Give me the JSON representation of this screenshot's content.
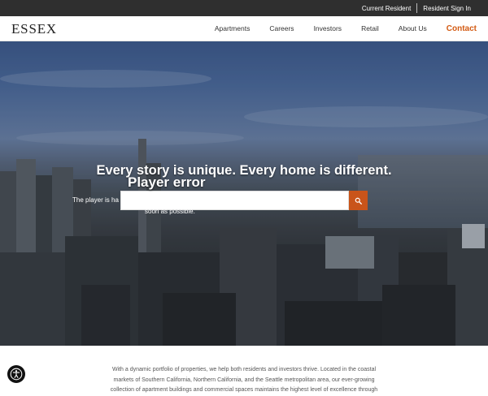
{
  "topbar": {
    "current_resident": "Current Resident",
    "resident_sign_in": "Resident Sign In"
  },
  "brand": {
    "logo": "ESSEX"
  },
  "nav": {
    "items": [
      "Apartments",
      "Careers",
      "Investors",
      "Retail",
      "About Us"
    ],
    "contact": "Contact"
  },
  "hero": {
    "headline": "Every story is unique. Every home is different.",
    "search_placeholder": "",
    "player_error_title": "Player error",
    "player_error_line1": "The player is ha",
    "player_error_line2": "soon as possible."
  },
  "about": {
    "text": "With a dynamic portfolio of properties, we help both residents and investors thrive. Located in the coastal markets of Southern California, Northern California, and the Seattle metropolitan area, our ever-growing collection of apartment buildings and commercial spaces maintains the highest level of excellence through"
  },
  "colors": {
    "accent": "#c9541a",
    "contact": "#d35a12",
    "topbar": "#2f2f2f"
  },
  "icons": {
    "search": "search-icon",
    "accessibility": "accessibility-icon"
  }
}
